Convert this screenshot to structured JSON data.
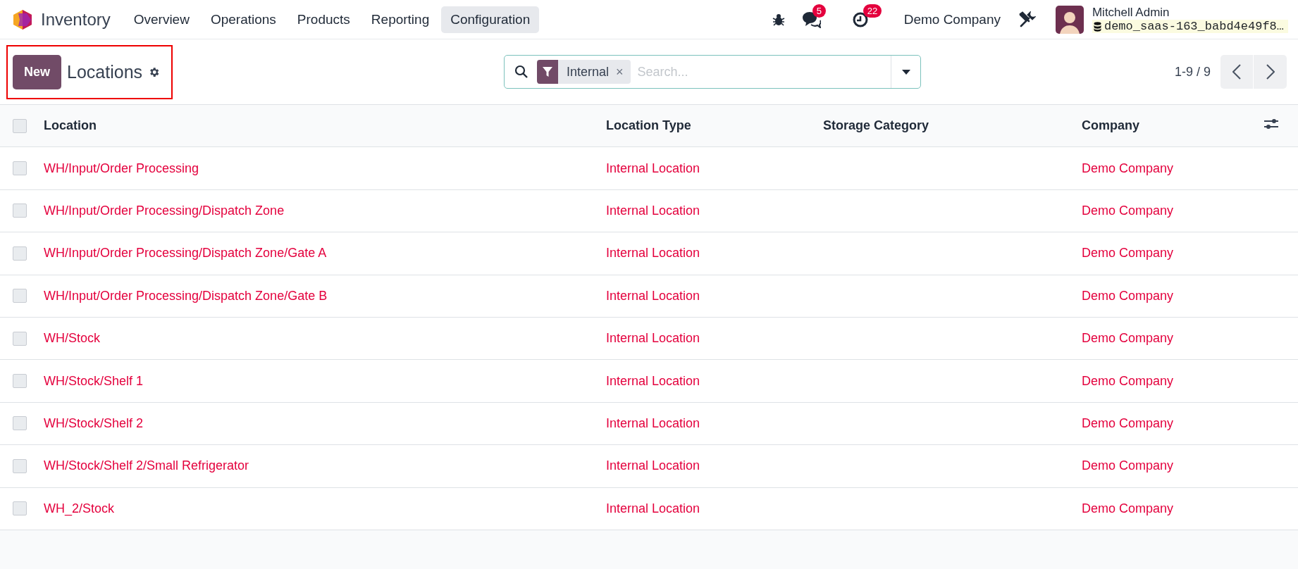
{
  "navbar": {
    "app": "Inventory",
    "menus": [
      {
        "label": "Overview",
        "selected": false
      },
      {
        "label": "Operations",
        "selected": false
      },
      {
        "label": "Products",
        "selected": false
      },
      {
        "label": "Reporting",
        "selected": false
      },
      {
        "label": "Configuration",
        "selected": true
      }
    ],
    "messages_count": "5",
    "activities_count": "22",
    "company": "Demo Company",
    "user": "Mitchell Admin",
    "database": "demo_saas-163_babd4e49f8…"
  },
  "control_panel": {
    "new_button": "New",
    "title": "Locations",
    "filter": "Internal",
    "filter_remove": "×",
    "search": {
      "placeholder": "Search..."
    },
    "pager": "1-9 / 9"
  },
  "table": {
    "columns": [
      "Location",
      "Location Type",
      "Storage Category",
      "Company"
    ],
    "all_checked": false,
    "rows": [
      {
        "checked": false,
        "location": "WH/Input/Order Processing",
        "type": "Internal Location",
        "storage_category": "",
        "company": "Demo Company"
      },
      {
        "checked": false,
        "location": "WH/Input/Order Processing/Dispatch Zone",
        "type": "Internal Location",
        "storage_category": "",
        "company": "Demo Company"
      },
      {
        "checked": false,
        "location": "WH/Input/Order Processing/Dispatch Zone/Gate A",
        "type": "Internal Location",
        "storage_category": "",
        "company": "Demo Company"
      },
      {
        "checked": false,
        "location": "WH/Input/Order Processing/Dispatch Zone/Gate B",
        "type": "Internal Location",
        "storage_category": "",
        "company": "Demo Company"
      },
      {
        "checked": false,
        "location": "WH/Stock",
        "type": "Internal Location",
        "storage_category": "",
        "company": "Demo Company"
      },
      {
        "checked": false,
        "location": "WH/Stock/Shelf 1",
        "type": "Internal Location",
        "storage_category": "",
        "company": "Demo Company"
      },
      {
        "checked": false,
        "location": "WH/Stock/Shelf 2",
        "type": "Internal Location",
        "storage_category": "",
        "company": "Demo Company"
      },
      {
        "checked": false,
        "location": "WH/Stock/Shelf 2/Small Refrigerator",
        "type": "Internal Location",
        "storage_category": "",
        "company": "Demo Company"
      },
      {
        "checked": false,
        "location": "WH_2/Stock",
        "type": "Internal Location",
        "storage_category": "",
        "company": "Demo Company"
      }
    ]
  }
}
